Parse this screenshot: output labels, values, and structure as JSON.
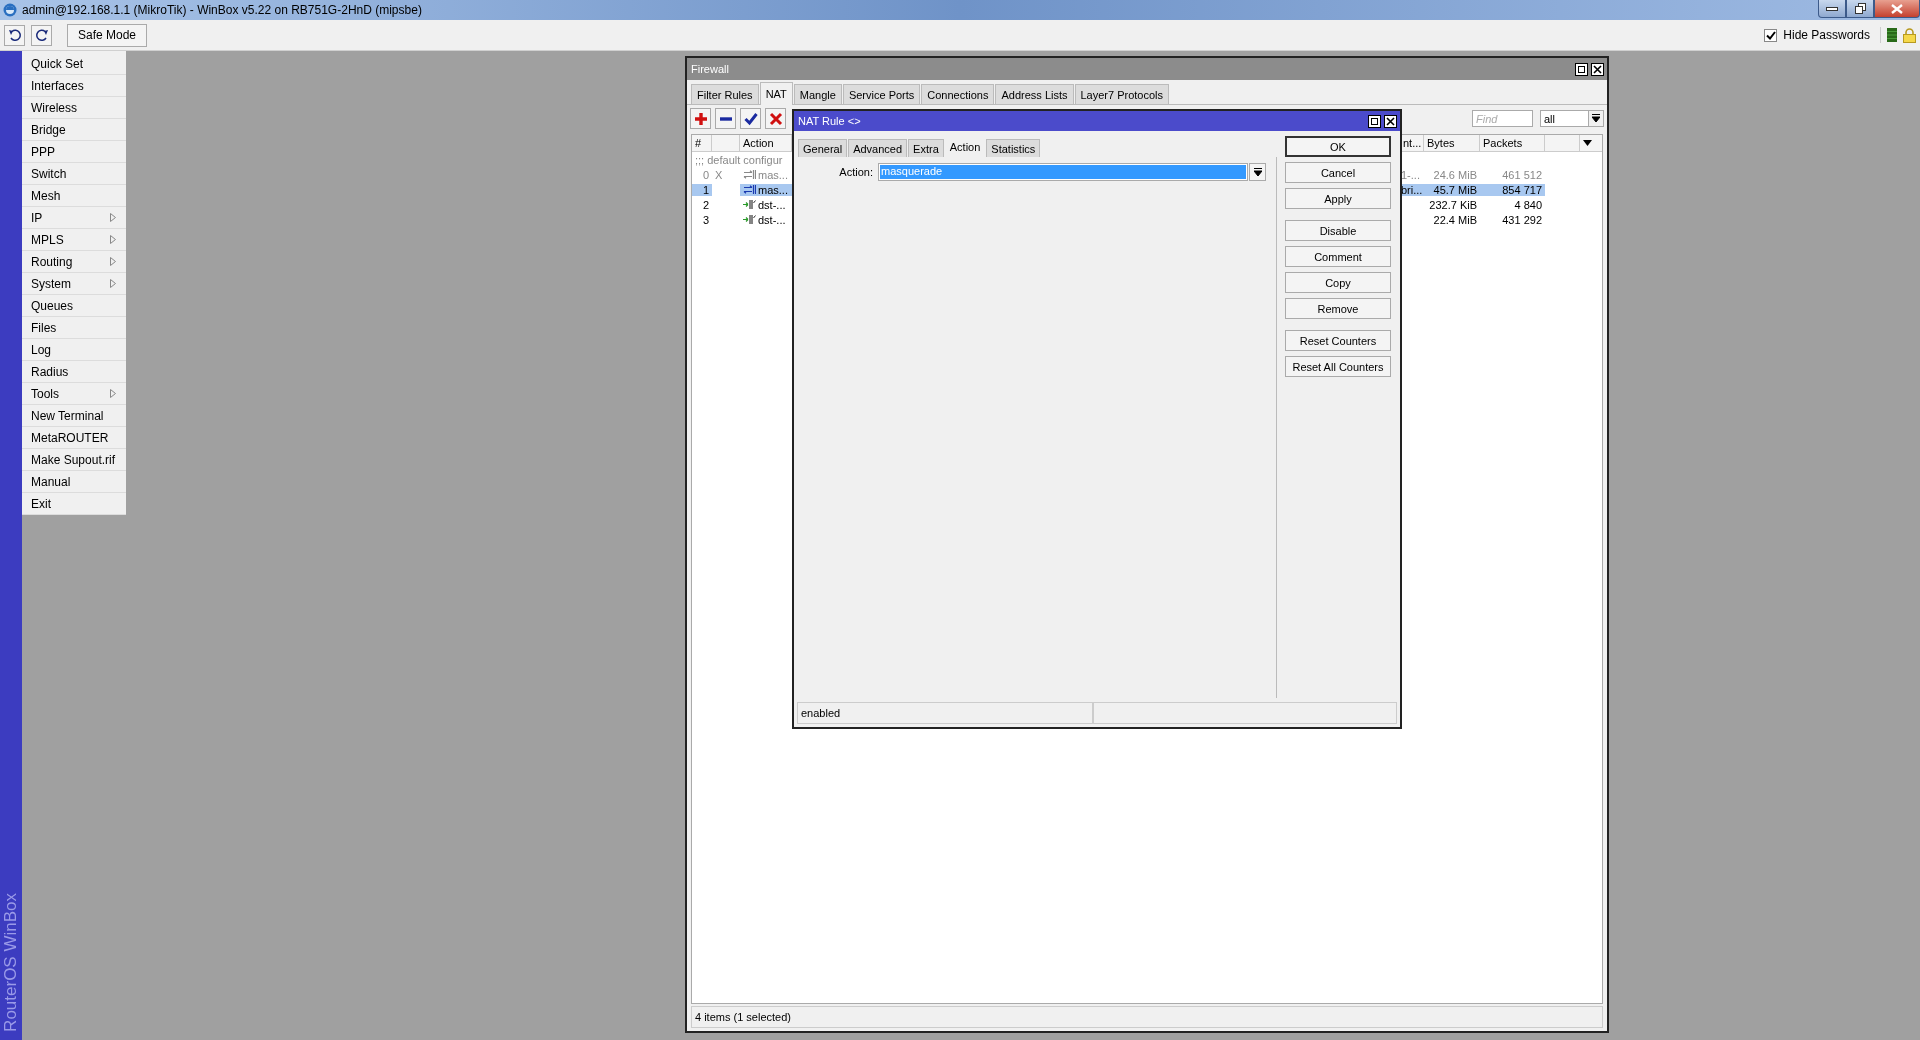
{
  "window": {
    "title": "admin@192.168.1.1 (MikroTik) - WinBox v5.22 on RB751G-2HnD (mipsbe)"
  },
  "toolbar": {
    "safe_mode": {
      "label": "Safe Mode",
      "on": false
    },
    "hide_passwords": {
      "label": "Hide Passwords",
      "checked": true
    }
  },
  "sidebar": {
    "brand": "RouterOS WinBox",
    "items": [
      {
        "label": "Quick Set",
        "submenu": false
      },
      {
        "label": "Interfaces",
        "submenu": false
      },
      {
        "label": "Wireless",
        "submenu": false
      },
      {
        "label": "Bridge",
        "submenu": false
      },
      {
        "label": "PPP",
        "submenu": false
      },
      {
        "label": "Switch",
        "submenu": false
      },
      {
        "label": "Mesh",
        "submenu": false
      },
      {
        "label": "IP",
        "submenu": true
      },
      {
        "label": "MPLS",
        "submenu": true
      },
      {
        "label": "Routing",
        "submenu": true
      },
      {
        "label": "System",
        "submenu": true
      },
      {
        "label": "Queues",
        "submenu": false
      },
      {
        "label": "Files",
        "submenu": false
      },
      {
        "label": "Log",
        "submenu": false
      },
      {
        "label": "Radius",
        "submenu": false
      },
      {
        "label": "Tools",
        "submenu": true
      },
      {
        "label": "New Terminal",
        "submenu": false
      },
      {
        "label": "MetaROUTER",
        "submenu": false
      },
      {
        "label": "Make Supout.rif",
        "submenu": false
      },
      {
        "label": "Manual",
        "submenu": false
      },
      {
        "label": "Exit",
        "submenu": false
      }
    ]
  },
  "firewall": {
    "title": "Firewall",
    "tabs": [
      {
        "label": "Filter Rules",
        "selected": false
      },
      {
        "label": "NAT",
        "selected": true
      },
      {
        "label": "Mangle",
        "selected": false
      },
      {
        "label": "Service Ports",
        "selected": false
      },
      {
        "label": "Connections",
        "selected": false
      },
      {
        "label": "Address Lists",
        "selected": false
      },
      {
        "label": "Layer7 Protocols",
        "selected": false
      }
    ],
    "tools": [
      {
        "kind": "add"
      },
      {
        "kind": "remove"
      },
      {
        "kind": "enable"
      },
      {
        "kind": "disable"
      }
    ],
    "find": {
      "placeholder": "Find"
    },
    "filter": {
      "value": "all"
    },
    "table": {
      "columns": [
        "#",
        "Action",
        "nt...",
        "Bytes",
        "Packets"
      ],
      "rows": [
        {
          "kind": "comment",
          "text": ";;; default configur",
          "selected": false
        },
        {
          "kind": "masquerade",
          "number": "0",
          "flag": "X",
          "action": "mas...",
          "column_4": "1-...",
          "bytes": "24.6 MiB",
          "packets": "461 512",
          "disabled": true,
          "selected": false
        },
        {
          "kind": "masquerade",
          "number": "1",
          "action": "mas...",
          "column_4": "bri...",
          "bytes": "45.7 MiB",
          "packets": "854 717",
          "disabled": false,
          "selected": true
        },
        {
          "kind": "dstnat",
          "number": "2",
          "action": "dst-...",
          "bytes": "232.7 KiB",
          "packets": "4 840",
          "disabled": false,
          "selected": false
        },
        {
          "kind": "dstnat",
          "number": "3",
          "action": "dst-...",
          "bytes": "22.4 MiB",
          "packets": "431 292",
          "disabled": false,
          "selected": false
        }
      ]
    },
    "status": "4 items (1 selected)"
  },
  "nat_rule": {
    "title": "NAT Rule <>",
    "tabs": [
      {
        "label": "General",
        "selected": false
      },
      {
        "label": "Advanced",
        "selected": false
      },
      {
        "label": "Extra",
        "selected": false
      },
      {
        "label": "Action",
        "selected": true
      },
      {
        "label": "Statistics",
        "selected": false
      }
    ],
    "fields": [
      {
        "label": "Action:",
        "value": "masquerade",
        "highlighted": true
      }
    ],
    "button_groups": [
      [
        {
          "label": "OK",
          "default": true
        },
        {
          "label": "Cancel",
          "default": false
        },
        {
          "label": "Apply",
          "default": false
        }
      ],
      [
        {
          "label": "Disable",
          "default": false
        },
        {
          "label": "Comment",
          "default": false
        },
        {
          "label": "Copy",
          "default": false
        },
        {
          "label": "Remove",
          "default": false
        }
      ],
      [
        {
          "label": "Reset Counters",
          "default": false
        },
        {
          "label": "Reset All Counters",
          "default": false
        }
      ]
    ],
    "status": "enabled"
  }
}
